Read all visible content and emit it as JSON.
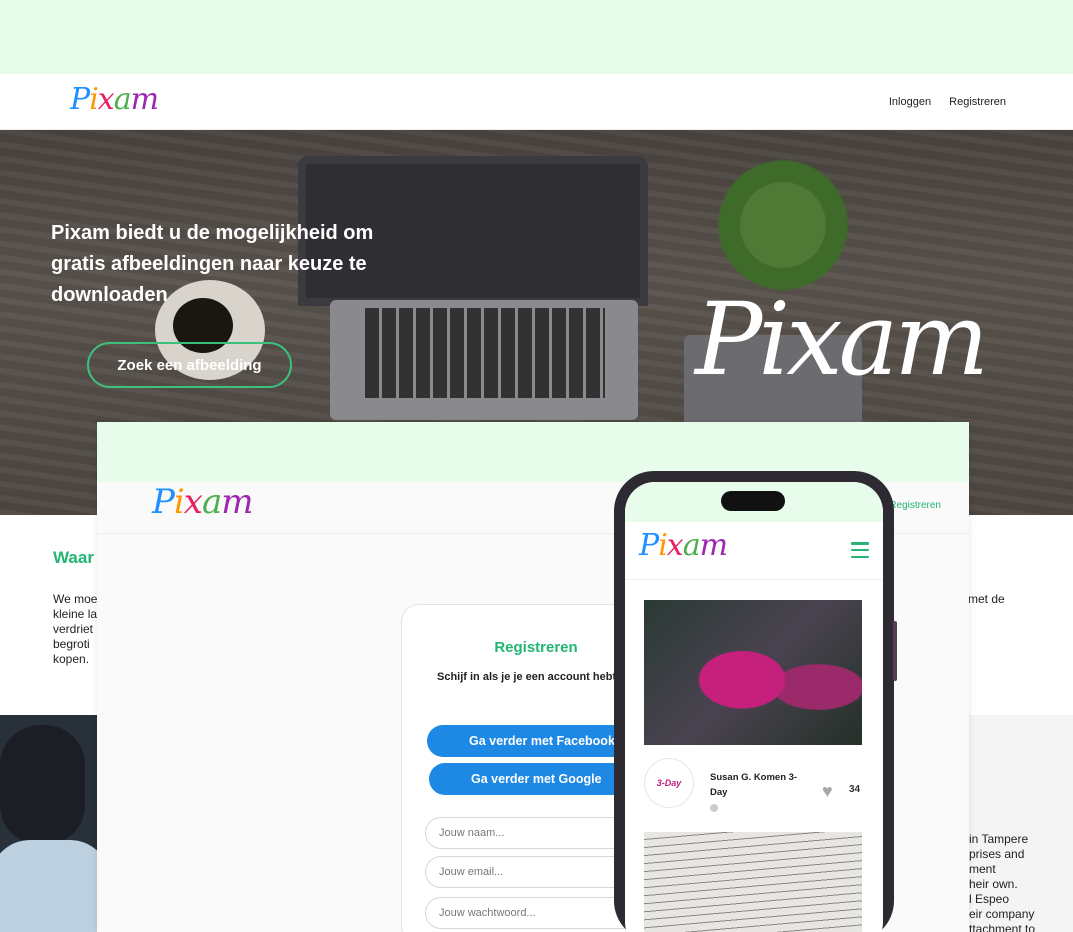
{
  "brand": {
    "logo_text": "Pixam"
  },
  "topnav": {
    "login": "Inloggen",
    "register": "Registreren"
  },
  "hero": {
    "title": "Pixam biedt u de mogelijkheid om gratis afbeeldingen naar keuze te downloaden",
    "cta": "Zoek een afbeelding",
    "logo_overlay": "Pixam"
  },
  "section": {
    "title": "Waar",
    "body_visible": "We moe\nkleine la\nverdriet\nbegroti\nkopen.",
    "right_fragment_1": "met de"
  },
  "lower": {
    "right_text": "in Tampere\nprises and\nment\nheir own.\nl Espeo\neir company\nttachment to"
  },
  "mock_desktop": {
    "register_link": "Registreren",
    "card": {
      "title": "Registreren",
      "subtitle": "Schijf in als je je een account hebt",
      "facebook": "Ga verder met Facebook",
      "google": "Ga verder met Google",
      "name_placeholder": "Jouw naam...",
      "email_placeholder": "Jouw email...",
      "password_placeholder": "Jouw wachtwoord..."
    }
  },
  "mock_phone": {
    "post": {
      "author": "Susan G. Komen 3-Day",
      "avatar_text": "3-Day",
      "likes": "34"
    }
  },
  "colors": {
    "accent_green": "#22b573",
    "button_blue": "#1e88e5",
    "mint_band": "#e8fcec"
  }
}
